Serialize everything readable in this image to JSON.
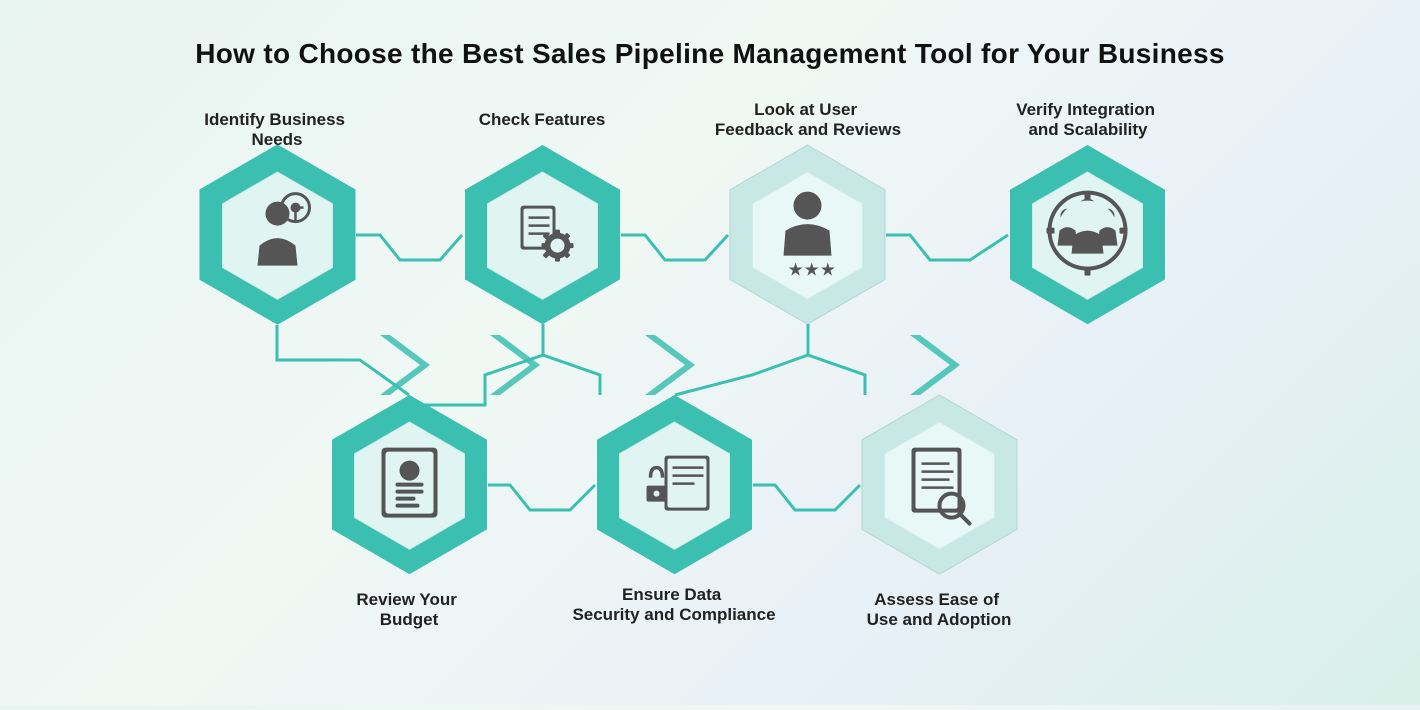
{
  "title": "How to Choose the Best Sales Pipeline Management Tool for Your Business",
  "colors": {
    "teal": "#3ABFB0",
    "teal_dark": "#2DADA0",
    "light_hex": "#e8f5f3",
    "icon_color": "#444",
    "connector": "#3ABFB0"
  },
  "top_items": [
    {
      "id": "identify",
      "label": "Identify Business\nNeeds",
      "icon": "target-person"
    },
    {
      "id": "check-features",
      "label": "Check Features",
      "icon": "checklist-gear"
    },
    {
      "id": "user-feedback",
      "label": "Look at User\nFeedback and Reviews",
      "icon": "user-stars"
    },
    {
      "id": "verify-integration",
      "label": "Verify Integration\nand Scalability",
      "icon": "team-gear"
    }
  ],
  "bottom_items": [
    {
      "id": "review-budget",
      "label": "Review Your\nBudget",
      "icon": "id-document"
    },
    {
      "id": "data-security",
      "label": "Ensure Data\nSecurity and Compliance",
      "icon": "lock-document"
    },
    {
      "id": "ease-of-use",
      "label": "Assess Ease of\nUse and Adoption",
      "icon": "document-search"
    }
  ]
}
